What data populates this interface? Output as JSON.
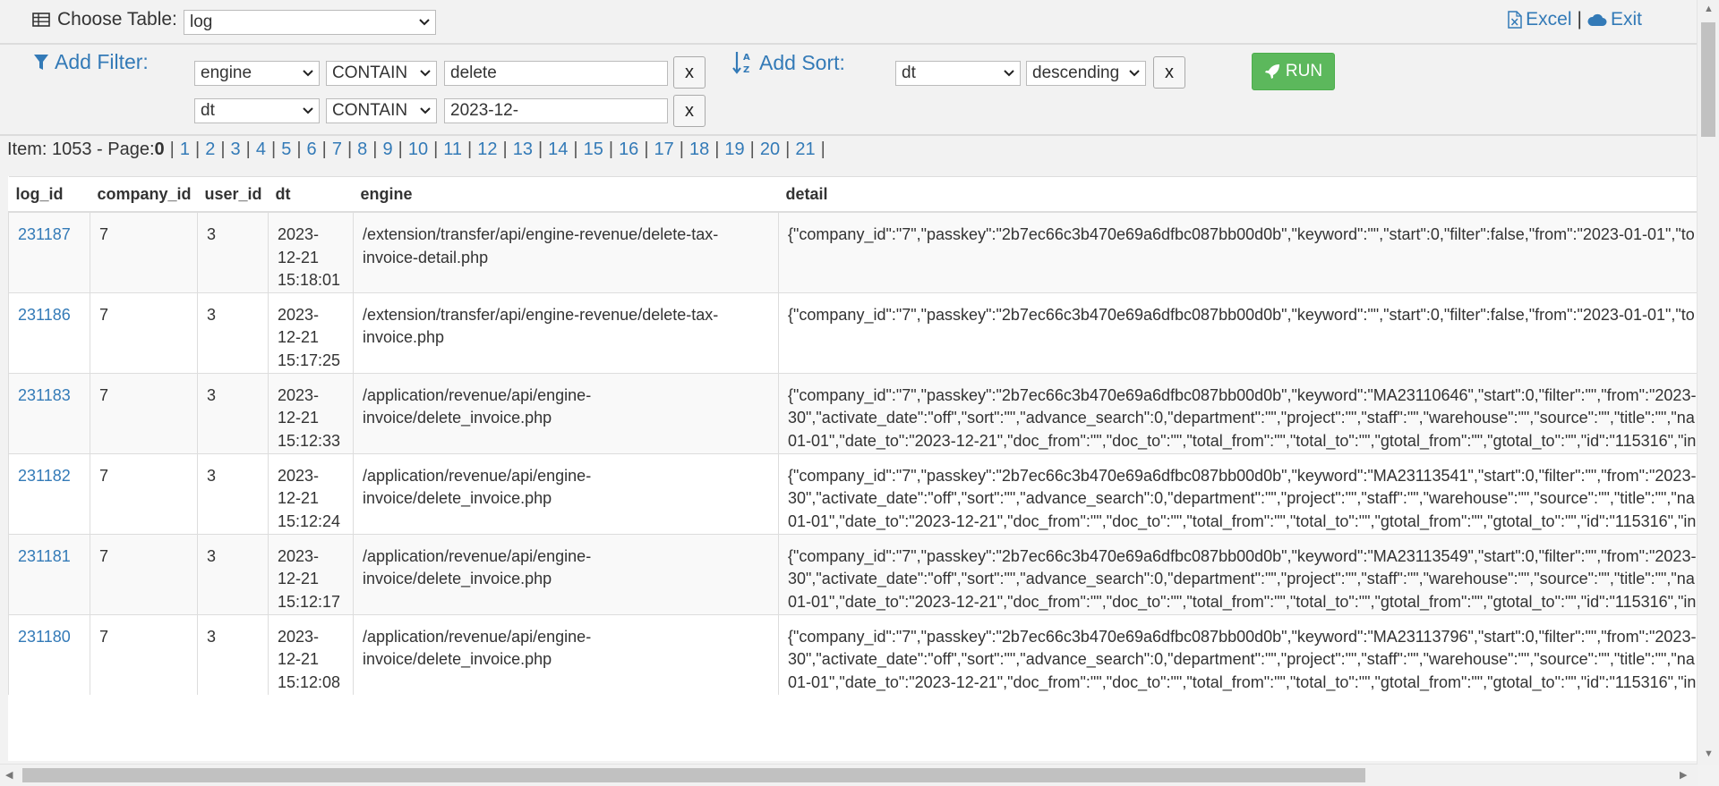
{
  "header": {
    "choose_label": "Choose Table:",
    "table_value": "log",
    "excel_label": "Excel",
    "separator": "|",
    "exit_label": "Exit"
  },
  "filter": {
    "label": "Add Filter:",
    "rows": [
      {
        "field": "engine",
        "op": "CONTAIN",
        "value": "delete",
        "remove": "x"
      },
      {
        "field": "dt",
        "op": "CONTAIN",
        "value": "2023-12-",
        "remove": "x"
      }
    ]
  },
  "sort": {
    "label": "Add Sort:",
    "field": "dt",
    "direction": "descending",
    "remove": "x"
  },
  "run_label": "RUN",
  "pager": {
    "item_prefix": "Item: 1053 - Page:",
    "current": "0",
    "pages": [
      "1",
      "2",
      "3",
      "4",
      "5",
      "6",
      "7",
      "8",
      "9",
      "10",
      "11",
      "12",
      "13",
      "14",
      "15",
      "16",
      "17",
      "18",
      "19",
      "20",
      "21"
    ]
  },
  "table": {
    "columns": [
      "log_id",
      "company_id",
      "user_id",
      "dt",
      "engine",
      "detail"
    ],
    "rows": [
      {
        "log_id": "231187",
        "company_id": "7",
        "user_id": "3",
        "dt": "2023-\n12-21\n15:18:01",
        "engine": "/extension/transfer/api/engine-revenue/delete-tax-\ninvoice-detail.php",
        "detail": "{\"company_id\":\"7\",\"passkey\":\"2b7ec66c3b470e69a6dfbc087bb00d0b\",\"keyword\":\"\",\"start\":0,\"filter\":false,\"from\":\"2023-01-01\",\"to"
      },
      {
        "log_id": "231186",
        "company_id": "7",
        "user_id": "3",
        "dt": "2023-\n12-21\n15:17:25",
        "engine": "/extension/transfer/api/engine-revenue/delete-tax-\ninvoice.php",
        "detail": "{\"company_id\":\"7\",\"passkey\":\"2b7ec66c3b470e69a6dfbc087bb00d0b\",\"keyword\":\"\",\"start\":0,\"filter\":false,\"from\":\"2023-01-01\",\"to"
      },
      {
        "log_id": "231183",
        "company_id": "7",
        "user_id": "3",
        "dt": "2023-\n12-21\n15:12:33",
        "engine": "/application/revenue/api/engine-\ninvoice/delete_invoice.php",
        "detail": "{\"company_id\":\"7\",\"passkey\":\"2b7ec66c3b470e69a6dfbc087bb00d0b\",\"keyword\":\"MA23110646\",\"start\":0,\"filter\":\"\",\"from\":\"2023-\n30\",\"activate_date\":\"off\",\"sort\":\"\",\"advance_search\":0,\"department\":\"\",\"project\":\"\",\"staff\":\"\",\"warehouse\":\"\",\"source\":\"\",\"title\":\"\",\"na\n01-01\",\"date_to\":\"2023-12-21\",\"doc_from\":\"\",\"doc_to\":\"\",\"total_from\":\"\",\"total_to\":\"\",\"gtotal_from\":\"\",\"gtotal_to\":\"\",\"id\":\"115316\",\"in"
      },
      {
        "log_id": "231182",
        "company_id": "7",
        "user_id": "3",
        "dt": "2023-\n12-21\n15:12:24",
        "engine": "/application/revenue/api/engine-\ninvoice/delete_invoice.php",
        "detail": "{\"company_id\":\"7\",\"passkey\":\"2b7ec66c3b470e69a6dfbc087bb00d0b\",\"keyword\":\"MA23113541\",\"start\":0,\"filter\":\"\",\"from\":\"2023-\n30\",\"activate_date\":\"off\",\"sort\":\"\",\"advance_search\":0,\"department\":\"\",\"project\":\"\",\"staff\":\"\",\"warehouse\":\"\",\"source\":\"\",\"title\":\"\",\"na\n01-01\",\"date_to\":\"2023-12-21\",\"doc_from\":\"\",\"doc_to\":\"\",\"total_from\":\"\",\"total_to\":\"\",\"gtotal_from\":\"\",\"gtotal_to\":\"\",\"id\":\"115316\",\"in"
      },
      {
        "log_id": "231181",
        "company_id": "7",
        "user_id": "3",
        "dt": "2023-\n12-21\n15:12:17",
        "engine": "/application/revenue/api/engine-\ninvoice/delete_invoice.php",
        "detail": "{\"company_id\":\"7\",\"passkey\":\"2b7ec66c3b470e69a6dfbc087bb00d0b\",\"keyword\":\"MA23113549\",\"start\":0,\"filter\":\"\",\"from\":\"2023-\n30\",\"activate_date\":\"off\",\"sort\":\"\",\"advance_search\":0,\"department\":\"\",\"project\":\"\",\"staff\":\"\",\"warehouse\":\"\",\"source\":\"\",\"title\":\"\",\"na\n01-01\",\"date_to\":\"2023-12-21\",\"doc_from\":\"\",\"doc_to\":\"\",\"total_from\":\"\",\"total_to\":\"\",\"gtotal_from\":\"\",\"gtotal_to\":\"\",\"id\":\"115316\",\"in"
      },
      {
        "log_id": "231180",
        "company_id": "7",
        "user_id": "3",
        "dt": "2023-\n12-21\n15:12:08",
        "engine": "/application/revenue/api/engine-\ninvoice/delete_invoice.php",
        "detail": "{\"company_id\":\"7\",\"passkey\":\"2b7ec66c3b470e69a6dfbc087bb00d0b\",\"keyword\":\"MA23113796\",\"start\":0,\"filter\":\"\",\"from\":\"2023-\n30\",\"activate_date\":\"off\",\"sort\":\"\",\"advance_search\":0,\"department\":\"\",\"project\":\"\",\"staff\":\"\",\"warehouse\":\"\",\"source\":\"\",\"title\":\"\",\"na\n01-01\",\"date_to\":\"2023-12-21\",\"doc_from\":\"\",\"doc_to\":\"\",\"total_from\":\"\",\"total_to\":\"\",\"gtotal_from\":\"\",\"gtotal_to\":\"\",\"id\":\"115316\",\"in"
      }
    ]
  }
}
